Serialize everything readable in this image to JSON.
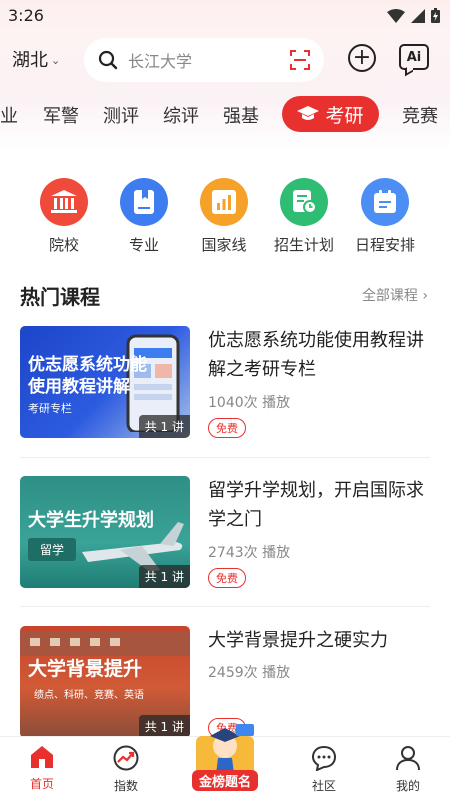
{
  "status": {
    "time": "3:26"
  },
  "header": {
    "location": "湖北",
    "search_placeholder": "长江大学",
    "ai_label": "Ai"
  },
  "tabs": [
    {
      "label": "业"
    },
    {
      "label": "军警"
    },
    {
      "label": "测评"
    },
    {
      "label": "综评"
    },
    {
      "label": "强基"
    },
    {
      "label": "考研"
    },
    {
      "label": "竞赛"
    }
  ],
  "quick_links": [
    {
      "label": "院校",
      "color": "#ef4a3a",
      "icon": "school-building-icon"
    },
    {
      "label": "专业",
      "color": "#3d7df0",
      "icon": "book-icon"
    },
    {
      "label": "国家线",
      "color": "#f5a12a",
      "icon": "bar-chart-icon"
    },
    {
      "label": "招生计划",
      "color": "#2ebd72",
      "icon": "plan-clock-icon"
    },
    {
      "label": "日程安排",
      "color": "#4d8ef5",
      "icon": "calendar-icon"
    }
  ],
  "section": {
    "title": "热门课程",
    "more": "全部课程"
  },
  "courses": [
    {
      "title": "优志愿系统功能使用教程讲解之考研专栏",
      "plays": "1040次 播放",
      "badge": "免费",
      "thumb_text": "优志愿系统功能使用教程讲解",
      "thumb_tag": "考研专栏",
      "thumb_count": "共 1 讲"
    },
    {
      "title": "留学升学规划，开启国际求学之门",
      "plays": "2743次 播放",
      "badge": "免费",
      "thumb_text": "大学生升学规划",
      "thumb_tag": "留学",
      "thumb_count": "共 1 讲"
    },
    {
      "title": "大学背景提升之硬实力",
      "plays": "2459次 播放",
      "badge": "免费",
      "thumb_text": "大学背景提升",
      "thumb_tag": "绩点、科研、竞赛、英语",
      "thumb_count": "共 1 讲"
    }
  ],
  "bottom_nav": [
    {
      "label": "首页"
    },
    {
      "label": "指数"
    },
    {
      "label": "金榜题名"
    },
    {
      "label": "社区"
    },
    {
      "label": "我的"
    }
  ],
  "colors": {
    "accent": "#e8312e"
  }
}
